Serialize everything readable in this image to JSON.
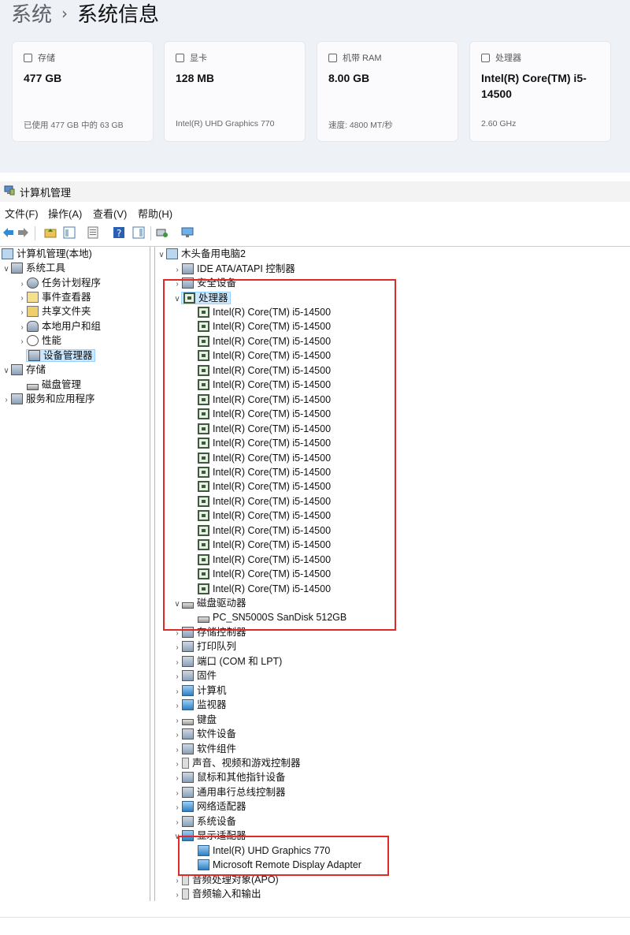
{
  "sysinfo": {
    "breadcrumb_parent": "系统",
    "breadcrumb_sep": "›",
    "breadcrumb_current": "系统信息",
    "cards": [
      {
        "label": "存储",
        "value": "477 GB",
        "sub": "已使用 477 GB 中的 63 GB",
        "icon": "storage-icon"
      },
      {
        "label": "显卡",
        "value": "128 MB",
        "sub": "Intel(R) UHD Graphics 770",
        "icon": "gpu-icon"
      },
      {
        "label": "机带 RAM",
        "value": "8.00 GB",
        "sub": "速度: 4800 MT/秒",
        "icon": "ram-icon"
      },
      {
        "label": "处理器",
        "value": "Intel(R) Core(TM) i5-14500",
        "sub": "2.60 GHz",
        "icon": "cpu-icon"
      }
    ]
  },
  "window": {
    "title": "计算机管理",
    "menu": [
      "文件(F)",
      "操作(A)",
      "查看(V)",
      "帮助(H)"
    ]
  },
  "left_tree": {
    "root": "计算机管理(本地)",
    "system_tools": "系统工具",
    "task_scheduler": "任务计划程序",
    "event_viewer": "事件查看器",
    "shared_folders": "共享文件夹",
    "local_users": "本地用户和组",
    "performance": "性能",
    "device_manager": "设备管理器",
    "storage": "存储",
    "disk_management": "磁盘管理",
    "services": "服务和应用程序"
  },
  "device_tree": {
    "computer": "木头备用电脑2",
    "ide": "IDE ATA/ATAPI 控制器",
    "security": "安全设备",
    "processors": "处理器",
    "cpu_name": "Intel(R) Core(TM) i5-14500",
    "cpu_count": 20,
    "disk_drives": "磁盘驱动器",
    "disk_name": "PC_SN5000S SanDisk 512GB",
    "storage_ctrl": "存储控制器",
    "print_queue": "打印队列",
    "ports": "端口 (COM 和 LPT)",
    "firmware": "固件",
    "computer_cat": "计算机",
    "monitors": "监视器",
    "keyboards": "键盘",
    "software_devices": "软件设备",
    "software_components": "软件组件",
    "sound": "声音、视频和游戏控制器",
    "mice": "鼠标和其他指针设备",
    "usb": "通用串行总线控制器",
    "network": "网络适配器",
    "system_devices": "系统设备",
    "display_adapters": "显示适配器",
    "gpu1": "Intel(R) UHD Graphics 770",
    "gpu2": "Microsoft Remote Display Adapter",
    "audio_apo": "音频处理对象(APO)",
    "audio_io": "音频输入和输出"
  },
  "colors": {
    "highlight": "#e02a2a",
    "selection": "#cce8ff"
  }
}
